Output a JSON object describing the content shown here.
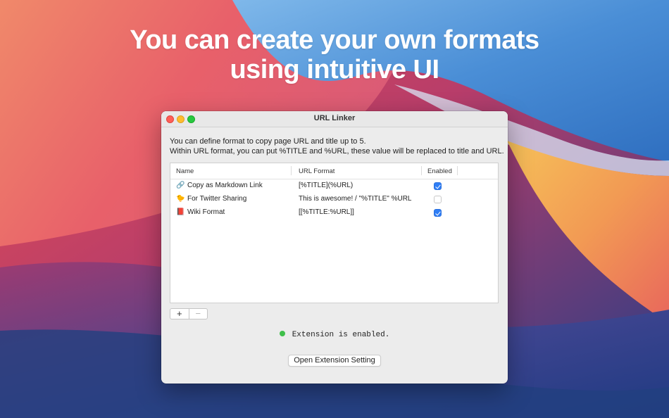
{
  "headline": {
    "line1": "You can create your own formats",
    "line2": "using intuitive UI"
  },
  "window": {
    "title": "URL Linker",
    "description_line1": "You can define format to copy page URL and title up to 5.",
    "description_line2": "Within URL format, you can put %TITLE and %URL, these value will be replaced to title and URL."
  },
  "table": {
    "columns": [
      "Name",
      "URL Format",
      "Enabled"
    ],
    "rows": [
      {
        "icon": "🔗",
        "icon_name": "link-icon",
        "name": "Copy as Markdown Link",
        "format": "[%TITLE](%URL)",
        "enabled": true
      },
      {
        "icon": "🐤",
        "icon_name": "bird-icon",
        "name": "For Twitter Sharing",
        "format": "This is awesome! / \"%TITLE\" %URL",
        "enabled": false
      },
      {
        "icon": "📕",
        "icon_name": "book-icon",
        "name": "Wiki Format",
        "format": "[[%TITLE:%URL]]",
        "enabled": true
      }
    ]
  },
  "controls": {
    "add_label": "+",
    "remove_label": "−"
  },
  "status": {
    "text": "Extension is enabled.",
    "color": "#3fbf4a"
  },
  "button": {
    "label": "Open Extension Setting"
  },
  "colors": {
    "accent": "#2f7ef6"
  }
}
